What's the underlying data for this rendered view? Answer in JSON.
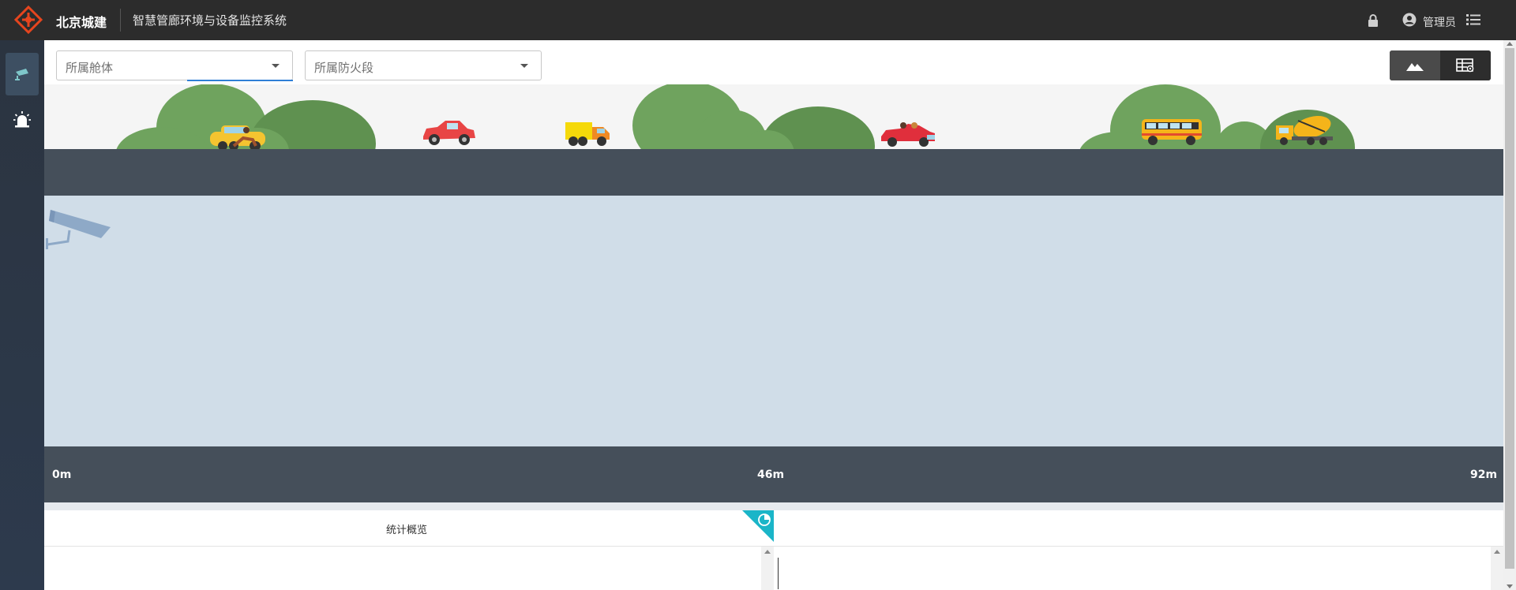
{
  "header": {
    "brand": "北京城建",
    "system_title": "智慧管廊环境与设备监控系统",
    "user_name": "管理员",
    "icons": {
      "logo": "logo-icon",
      "lock": "lock-icon",
      "user": "user-circle-icon",
      "menu": "list-menu-icon"
    },
    "brand_color": "#e6451e"
  },
  "sidebar": {
    "items": [
      {
        "name": "camera",
        "icon": "camera-icon",
        "active": true
      },
      {
        "name": "alarm",
        "icon": "alarm-light-icon",
        "active": false
      }
    ]
  },
  "filters": {
    "cabin_placeholder": "所属舱体",
    "fire_zone_placeholder": "所属防火段"
  },
  "view_toggle": {
    "options": [
      {
        "icon": "mountain-view-icon",
        "active": true
      },
      {
        "icon": "table-grid-icon",
        "active": false
      }
    ]
  },
  "scene": {
    "vehicles": [
      "taxi-motorcycle",
      "red-car",
      "yellow-truck",
      "red-convertible",
      "yellow-bus",
      "cement-mixer"
    ]
  },
  "ruler": {
    "start": "0m",
    "middle": "46m",
    "end": "92m"
  },
  "stats": {
    "title": "统计概览",
    "badge_icon": "pie-chart-icon"
  },
  "colors": {
    "topbar": "#2c2c2c",
    "road": "#454f5a",
    "tunnel": "#d0dde8",
    "accent_teal": "#1ab5c8"
  }
}
